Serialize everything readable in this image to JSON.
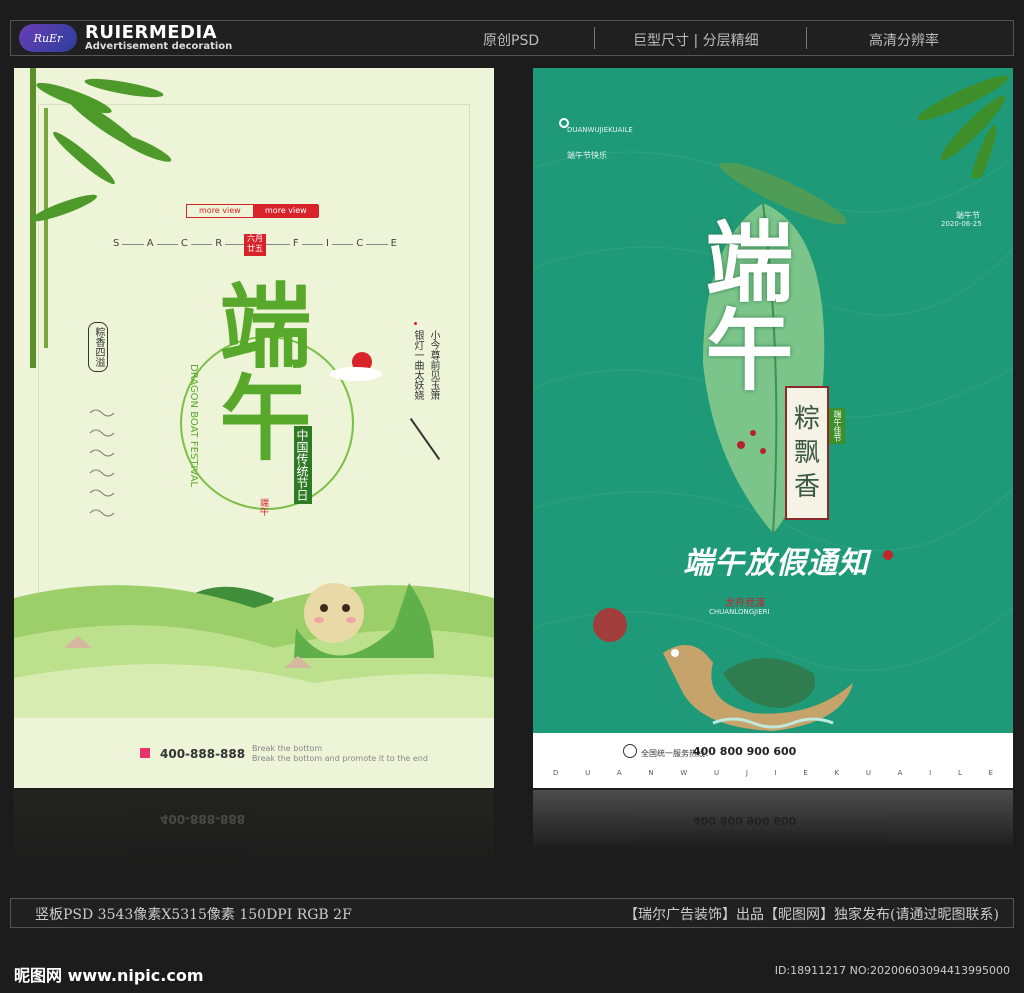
{
  "header": {
    "logo_text": "RuEr",
    "brand": "RUIERMEDIA",
    "brand_sub": "Advertisement decoration",
    "links": [
      "原创PSD",
      "巨型尺寸 | 分层精细",
      "高清分辨率"
    ]
  },
  "poster1": {
    "more_view_1": "more view",
    "more_view_2": "more view",
    "letters": [
      "S",
      "A",
      "C",
      "R",
      "F",
      "I",
      "C",
      "E"
    ],
    "seal_top": "六月",
    "seal_bottom": "廿五",
    "big_title": "端午",
    "vertical_en": "DRAGON BOAT FESTIVAL",
    "vertical_cn": "中国传统节日",
    "side_badge": "粽香四溢",
    "poem_col1": "小今尊前见玉箫",
    "poem_col2": "银灯一曲太妖娆",
    "small_seal": "端午",
    "phone": "400-888-888",
    "note1": "Break the bottom",
    "note2": "Break the bottom and promote it to the end",
    "reflect_phone": "400-888-888"
  },
  "poster2": {
    "top_en": "DUANWUJIEKUAILE",
    "top_cn": "端午节快乐",
    "date_cn": "端午节",
    "date": "2020-06-25",
    "big_title": "端午",
    "red_badge": "端午佳节",
    "zong_lines": [
      "粽",
      "飘",
      "香"
    ],
    "notice": "端午放假通知",
    "boat_cn": "龙舟竞渡",
    "boat_en": "CHUANLONGJIERI",
    "hotline_label": "全国统一服务热线：",
    "hotline": "400 800 900 600",
    "letters": [
      "D",
      "U",
      "A",
      "N",
      "W",
      "U",
      "J",
      "I",
      "E",
      "K",
      "U",
      "A",
      "I",
      "L",
      "E"
    ],
    "reflect_hotline": "400 800 900 600"
  },
  "footer": {
    "left": "竖板PSD 3543像素X5315像素 150DPI RGB 2F",
    "right": "【瑞尔广告装饰】出品【昵图网】独家发布(请通过昵图联系)"
  },
  "watermark": "昵图网 www.nipic.com",
  "id_text": "ID:18911217 NO:20200603094413995000",
  "colors": {
    "bg": "#1c1c1c",
    "poster1_bg": "#eef4d8",
    "poster2_bg": "#1f9a78",
    "accent_red": "#d8232a",
    "green": "#4caf50"
  }
}
